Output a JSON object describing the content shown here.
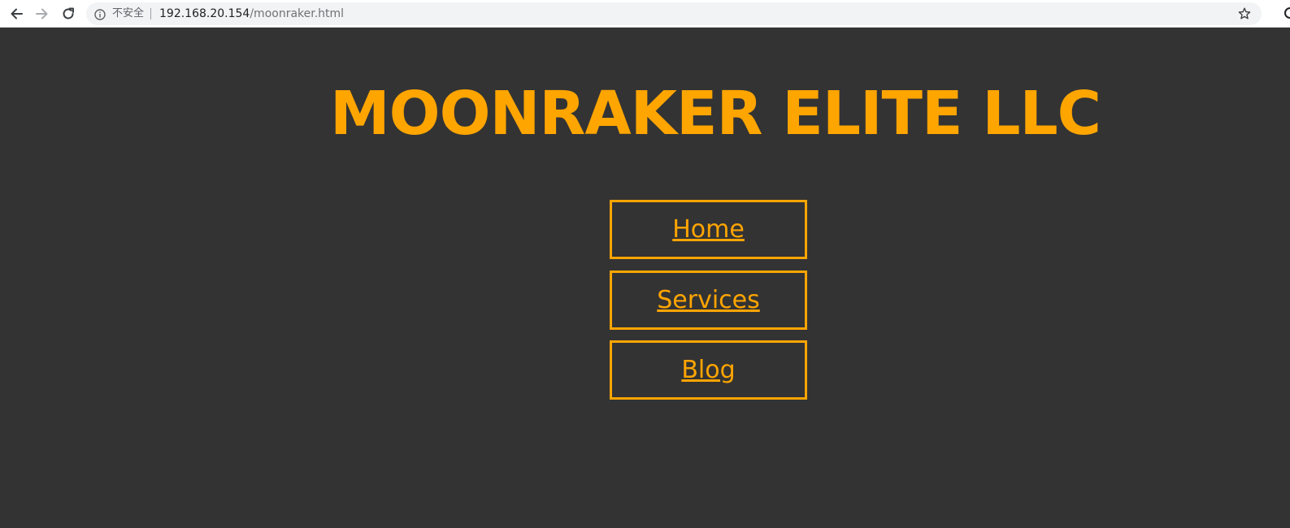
{
  "browser": {
    "security_label": "不安全",
    "url_host": "192.168.20.154",
    "url_path": "/moonraker.html",
    "icons": {
      "back": "arrow-left-icon",
      "forward": "arrow-right-icon",
      "reload": "reload-icon",
      "info": "info-circle-icon",
      "bookmark": "star-icon"
    }
  },
  "page": {
    "title": "MOONRAKER ELITE LLC",
    "nav": [
      {
        "label": "Home"
      },
      {
        "label": "Services"
      },
      {
        "label": "Blog"
      }
    ]
  },
  "colors": {
    "background": "#333333",
    "accent": "#ffa500"
  }
}
